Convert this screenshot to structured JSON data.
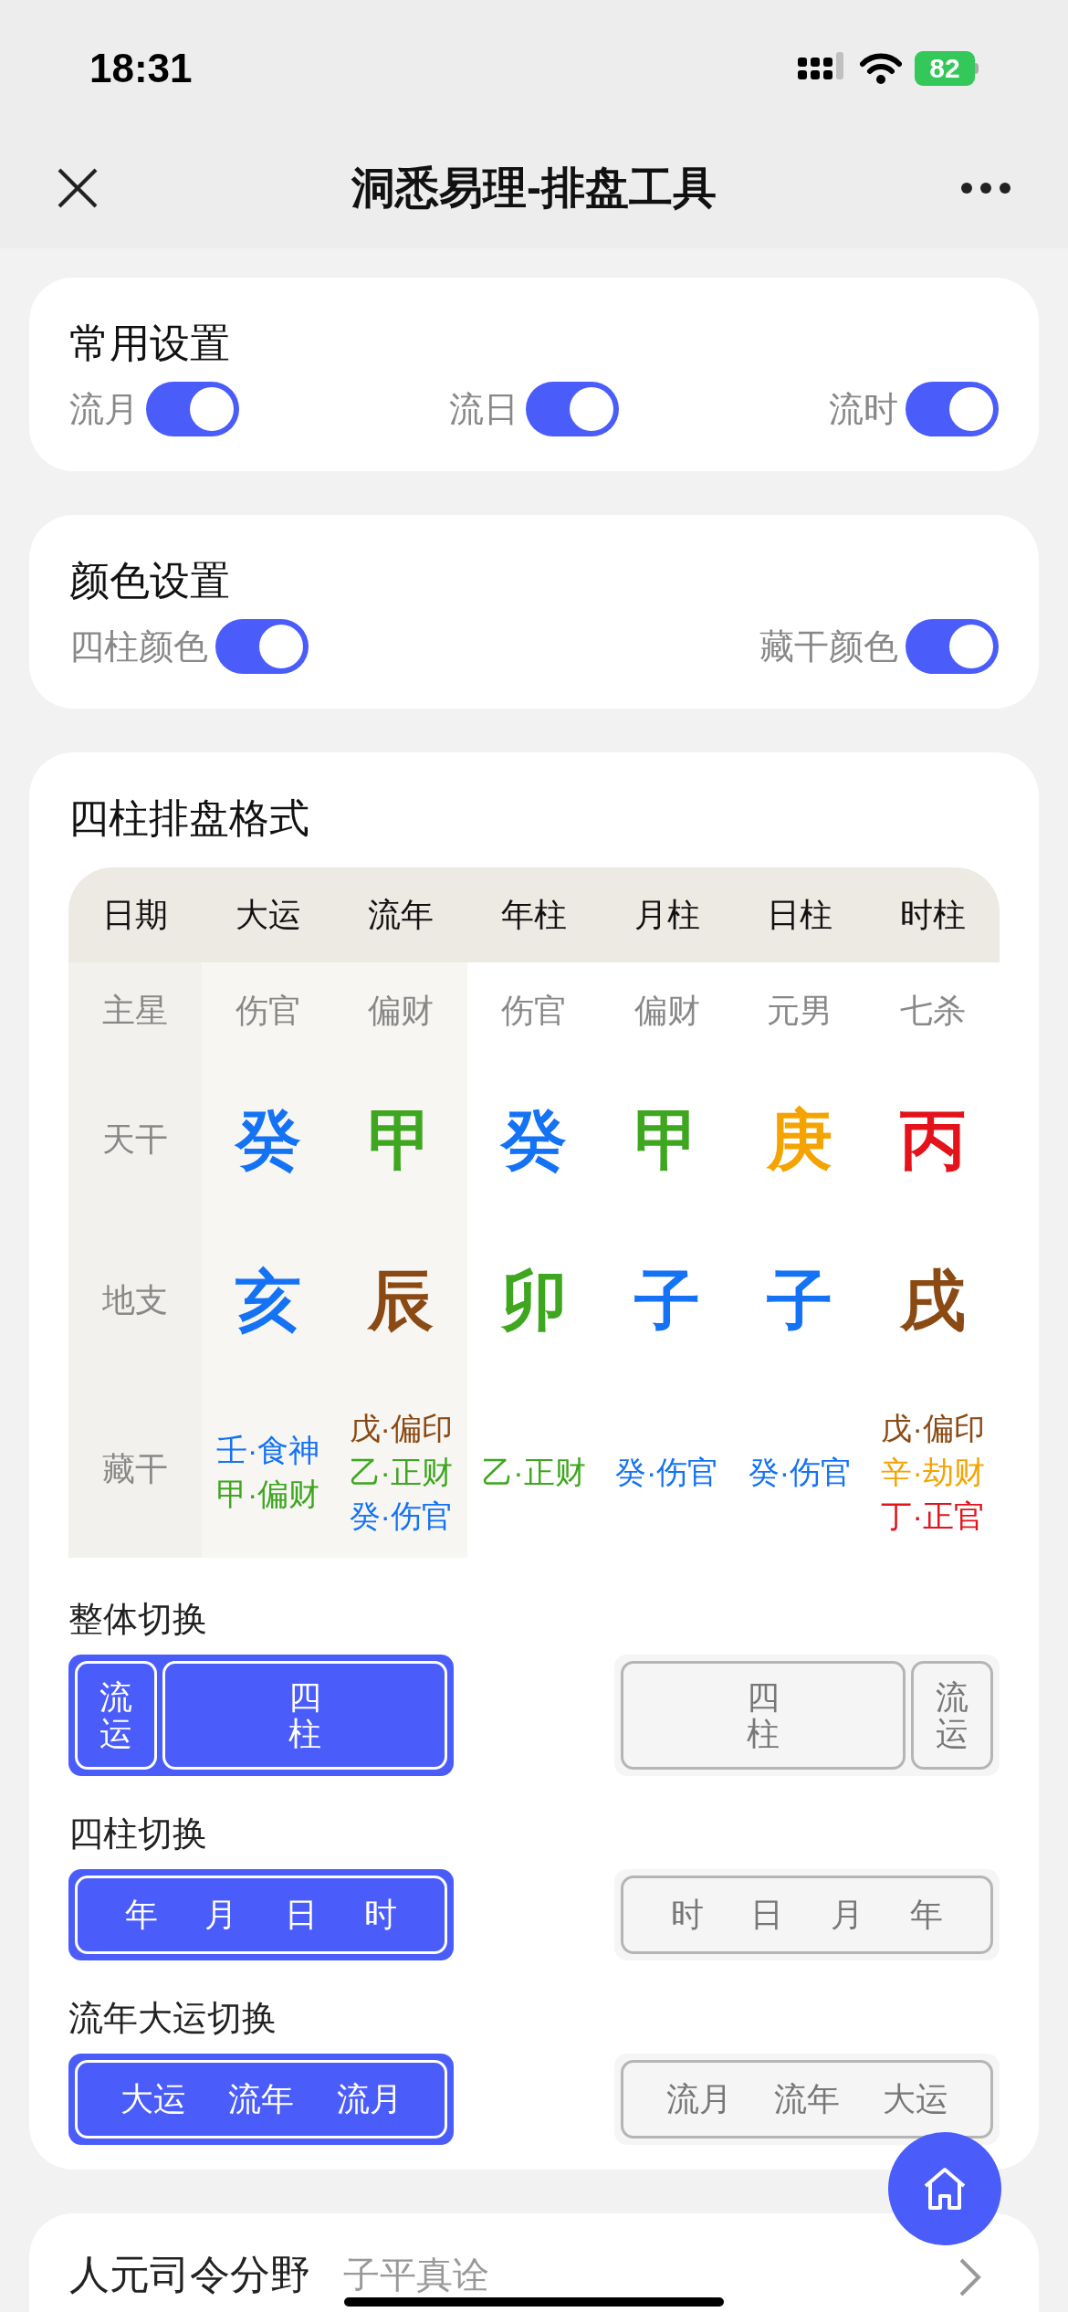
{
  "status_bar": {
    "time": "18:31",
    "battery": "82"
  },
  "nav": {
    "title": "洞悉易理-排盘工具"
  },
  "common_settings": {
    "title": "常用设置",
    "toggles": [
      {
        "label": "流月",
        "on": true
      },
      {
        "label": "流日",
        "on": true
      },
      {
        "label": "流时",
        "on": true
      }
    ]
  },
  "color_settings": {
    "title": "颜色设置",
    "toggles": [
      {
        "label": "四柱颜色",
        "on": true
      },
      {
        "label": "藏干颜色",
        "on": true
      }
    ]
  },
  "chart": {
    "title": "四柱排盘格式",
    "corner": {
      "label": "日期",
      "kind": "label"
    },
    "columns": [
      {
        "label": "大运",
        "kind": "luck"
      },
      {
        "label": "流年",
        "kind": "luck"
      },
      {
        "label": "年柱",
        "kind": "pillar"
      },
      {
        "label": "月柱",
        "kind": "pillar"
      },
      {
        "label": "日柱",
        "kind": "pillar"
      },
      {
        "label": "时柱",
        "kind": "pillar"
      }
    ],
    "rows": [
      {
        "label": "主星",
        "kind": "star",
        "cells": [
          {
            "lines": [
              {
                "text": "伤官",
                "color": "#888888"
              }
            ]
          },
          {
            "lines": [
              {
                "text": "偏财",
                "color": "#888888"
              }
            ]
          },
          {
            "lines": [
              {
                "text": "伤官",
                "color": "#888888"
              }
            ]
          },
          {
            "lines": [
              {
                "text": "偏财",
                "color": "#888888"
              }
            ]
          },
          {
            "lines": [
              {
                "text": "元男",
                "color": "#888888"
              }
            ]
          },
          {
            "lines": [
              {
                "text": "七杀",
                "color": "#888888"
              }
            ]
          }
        ]
      },
      {
        "label": "天干",
        "kind": "big",
        "cells": [
          {
            "lines": [
              {
                "text": "癸",
                "color": "#1472f5"
              }
            ]
          },
          {
            "lines": [
              {
                "text": "甲",
                "color": "#3ea61f"
              }
            ]
          },
          {
            "lines": [
              {
                "text": "癸",
                "color": "#1472f5"
              }
            ]
          },
          {
            "lines": [
              {
                "text": "甲",
                "color": "#3ea61f"
              }
            ]
          },
          {
            "lines": [
              {
                "text": "庚",
                "color": "#f5a300"
              }
            ]
          },
          {
            "lines": [
              {
                "text": "丙",
                "color": "#e4121a"
              }
            ]
          }
        ]
      },
      {
        "label": "地支",
        "kind": "big",
        "cells": [
          {
            "lines": [
              {
                "text": "亥",
                "color": "#1472f5"
              }
            ]
          },
          {
            "lines": [
              {
                "text": "辰",
                "color": "#8b4a14"
              }
            ]
          },
          {
            "lines": [
              {
                "text": "卯",
                "color": "#3ea61f"
              }
            ]
          },
          {
            "lines": [
              {
                "text": "子",
                "color": "#1472f5"
              }
            ]
          },
          {
            "lines": [
              {
                "text": "子",
                "color": "#1472f5"
              }
            ]
          },
          {
            "lines": [
              {
                "text": "戌",
                "color": "#8b4a14"
              }
            ]
          }
        ]
      },
      {
        "label": "藏干",
        "kind": "small",
        "cells": [
          {
            "lines": [
              {
                "text": "壬·食神",
                "color": "#1472f5"
              },
              {
                "text": "甲·偏财",
                "color": "#3ea61f"
              }
            ]
          },
          {
            "lines": [
              {
                "text": "戊·偏印",
                "color": "#8b4a14"
              },
              {
                "text": "乙·正财",
                "color": "#3ea61f"
              },
              {
                "text": "癸·伤官",
                "color": "#1472f5"
              }
            ]
          },
          {
            "lines": [
              {
                "text": "乙·正财",
                "color": "#3ea61f"
              }
            ]
          },
          {
            "lines": [
              {
                "text": "癸·伤官",
                "color": "#1472f5"
              }
            ]
          },
          {
            "lines": [
              {
                "text": "癸·伤官",
                "color": "#1472f5"
              }
            ]
          },
          {
            "lines": [
              {
                "text": "戊·偏印",
                "color": "#8b4a14"
              },
              {
                "text": "辛·劫财",
                "color": "#f5a300"
              },
              {
                "text": "丁·正官",
                "color": "#e4121a"
              }
            ]
          }
        ]
      }
    ]
  },
  "switches": [
    {
      "title": "整体切换",
      "kind": "tall",
      "options": [
        {
          "selected": true,
          "boxes": [
            {
              "text": "流运",
              "kind": "narrow"
            },
            {
              "text": "四柱",
              "kind": "wide"
            }
          ]
        },
        {
          "selected": false,
          "boxes": [
            {
              "text": "四柱",
              "kind": "wide"
            },
            {
              "text": "流运",
              "kind": "narrow"
            }
          ]
        }
      ]
    },
    {
      "title": "四柱切换",
      "kind": "row",
      "options": [
        {
          "selected": true,
          "boxes": [
            {
              "words": [
                "年",
                "月",
                "日",
                "时"
              ]
            }
          ]
        },
        {
          "selected": false,
          "boxes": [
            {
              "words": [
                "时",
                "日",
                "月",
                "年"
              ]
            }
          ]
        }
      ]
    },
    {
      "title": "流年大运切换",
      "kind": "row",
      "options": [
        {
          "selected": true,
          "boxes": [
            {
              "words": [
                "大运",
                "流年",
                "流月"
              ]
            }
          ]
        },
        {
          "selected": false,
          "boxes": [
            {
              "words": [
                "流月",
                "流年",
                "大运"
              ]
            }
          ]
        }
      ]
    }
  ],
  "bottom_card": {
    "title": "人元司令分野",
    "subtitle": "子平真诠"
  }
}
